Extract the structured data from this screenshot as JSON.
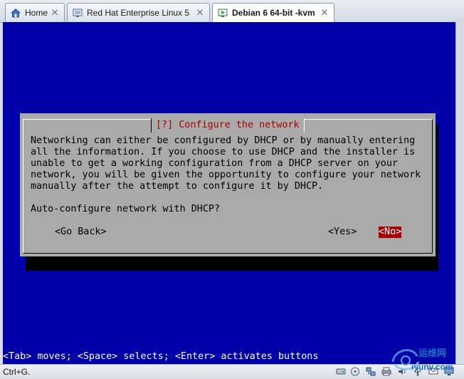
{
  "tabs": [
    {
      "label": "Home",
      "icon": "home-icon",
      "closable": true
    },
    {
      "label": "Red Hat Enterprise Linux 5",
      "icon": "vm-icon",
      "closable": true
    },
    {
      "label": "Debian 6 64-bit -kvm",
      "icon": "vm-running-icon",
      "closable": true,
      "active": true
    }
  ],
  "close_glyph": "✕",
  "dialog": {
    "title": "[?] Configure the network",
    "body": "Networking can either be configured by DHCP or by manually entering\nall the information. If you choose to use DHCP and the installer is\nunable to get a working configuration from a DHCP server on your\nnetwork, you will be given the opportunity to configure your network\nmanually after the attempt to configure it by DHCP.",
    "question": "Auto-configure network with DHCP?",
    "buttons": {
      "back": "<Go Back>",
      "yes": "<Yes>",
      "no": "<No>"
    },
    "selected_button": "no"
  },
  "help_line": "<Tab> moves; <Space> selects; <Enter> activates buttons",
  "status": {
    "hint": "Ctrl+G."
  },
  "watermark": {
    "brand": "运维网",
    "domain": "iyunv.com"
  },
  "colors": {
    "console_bg": "#0000a8",
    "dialog_bg": "#aaaaaa",
    "title_text": "#a80000",
    "selected_button_bg": "#a80000"
  }
}
